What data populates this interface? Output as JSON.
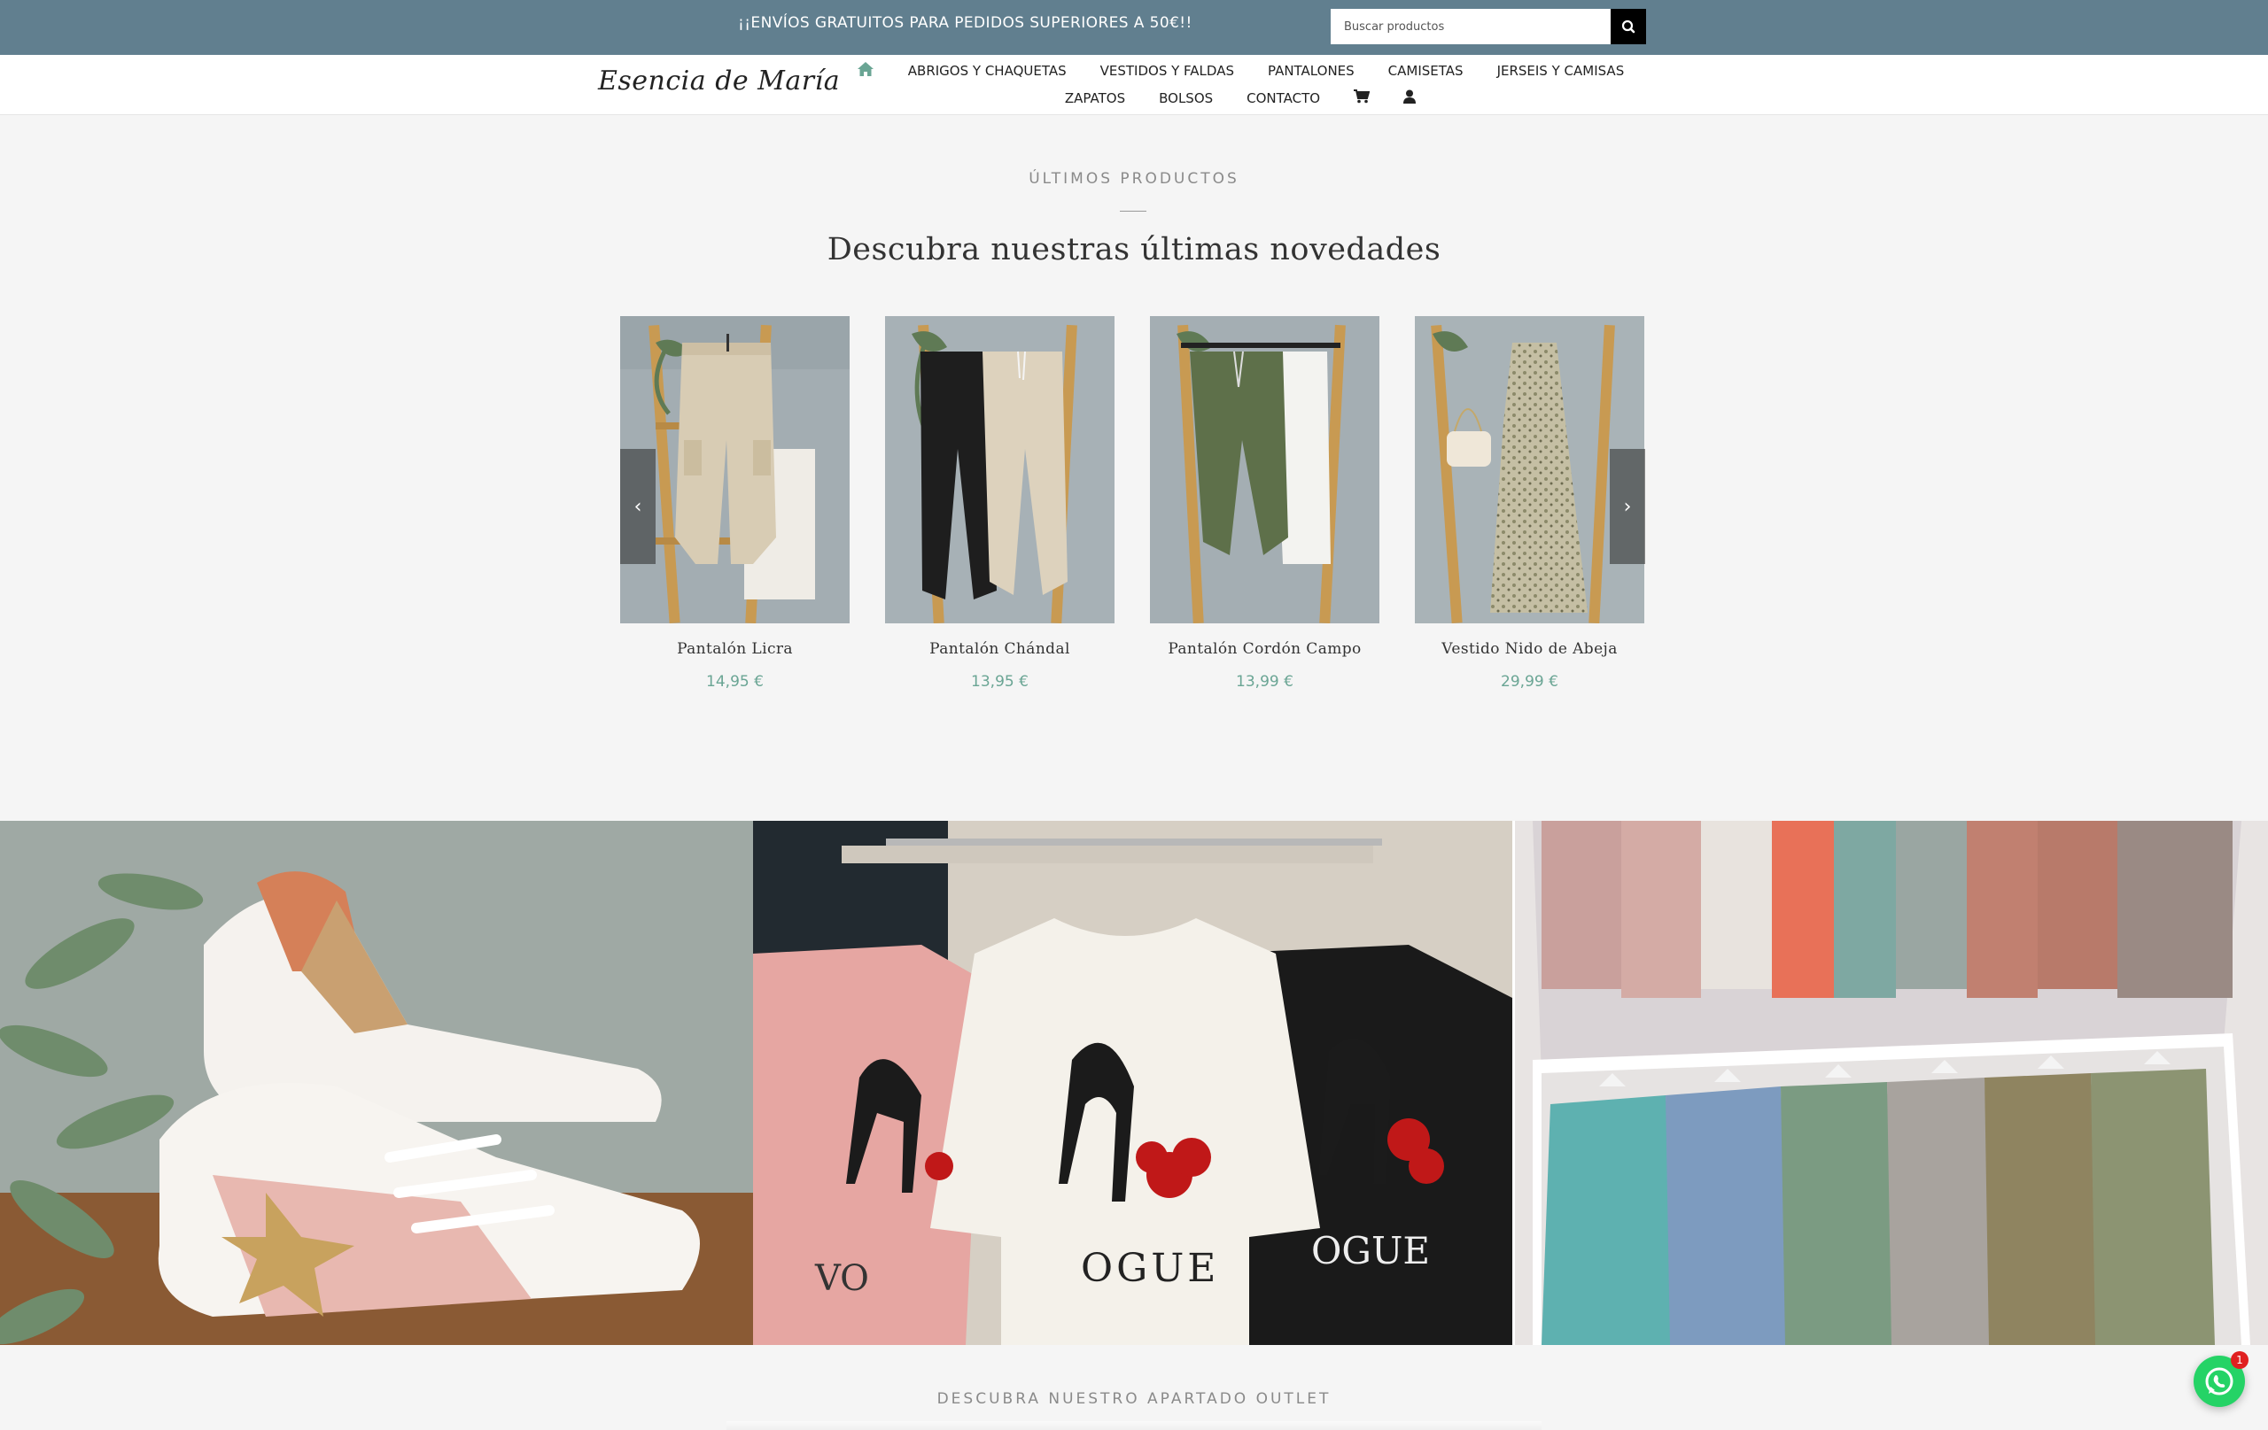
{
  "topbar": {
    "promo": "¡¡ENVÍOS GRATUITOS PARA PEDIDOS SUPERIORES A 50€!!",
    "search_placeholder": "Buscar productos",
    "bg_color": "#617f8f"
  },
  "header": {
    "logo": "Esencia de María",
    "nav_row1": [
      "ABRIGOS Y CHAQUETAS",
      "VESTIDOS Y FALDAS",
      "PANTALONES",
      "CAMISETAS",
      "JERSEIS Y CAMISAS"
    ],
    "nav_row2": [
      "ZAPATOS",
      "BOLSOS",
      "CONTACTO"
    ],
    "icons": [
      "home-icon",
      "cart-icon",
      "user-icon"
    ],
    "accent_color": "#6aa594"
  },
  "latest": {
    "kicker": "ÚLTIMOS PRODUCTOS",
    "heading": "Descubra nuestras últimas novedades",
    "products": [
      {
        "name": "Pantalón Licra",
        "price": "14,95 €"
      },
      {
        "name": "Pantalón Chándal",
        "price": "13,95 €"
      },
      {
        "name": "Pantalón Cordón Campo",
        "price": "13,99 €"
      },
      {
        "name": "Vestido Nido de Abeja",
        "price": "29,99 €"
      }
    ],
    "arrows": [
      "chevron-left-icon",
      "chevron-right-icon"
    ]
  },
  "outlet": {
    "kicker": "DESCUBRA NUESTRO APARTADO OUTLET"
  },
  "whatsapp": {
    "badge": "1"
  }
}
